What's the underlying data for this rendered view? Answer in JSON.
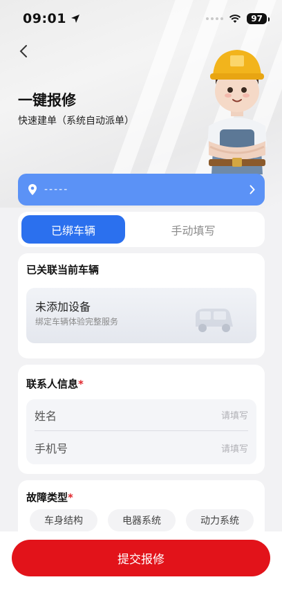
{
  "status_bar": {
    "time": "09:01",
    "battery": "97"
  },
  "header": {
    "title": "一键报修",
    "subtitle": "快速建单（系统自动派单）"
  },
  "location": {
    "text": "-----"
  },
  "tabs": [
    {
      "label": "已绑车辆",
      "active": true
    },
    {
      "label": "手动填写",
      "active": false
    }
  ],
  "vehicle": {
    "section_title": "已关联当前车辆",
    "device_title": "未添加设备",
    "device_desc": "绑定车辆体验完整服务"
  },
  "contact": {
    "section_title": "联系人信息",
    "required_mark": "*",
    "fields": [
      {
        "label": "姓名",
        "placeholder": "请填写"
      },
      {
        "label": "手机号",
        "placeholder": "请填写"
      }
    ]
  },
  "fault": {
    "section_title": "故障类型",
    "required_mark": "*",
    "options": [
      "车身结构",
      "电器系统",
      "动力系统"
    ]
  },
  "submit": {
    "label": "提交报修"
  },
  "colors": {
    "primary_blue": "#2b70ee",
    "location_blue": "#5b92f6",
    "submit_red": "#e2131a"
  }
}
